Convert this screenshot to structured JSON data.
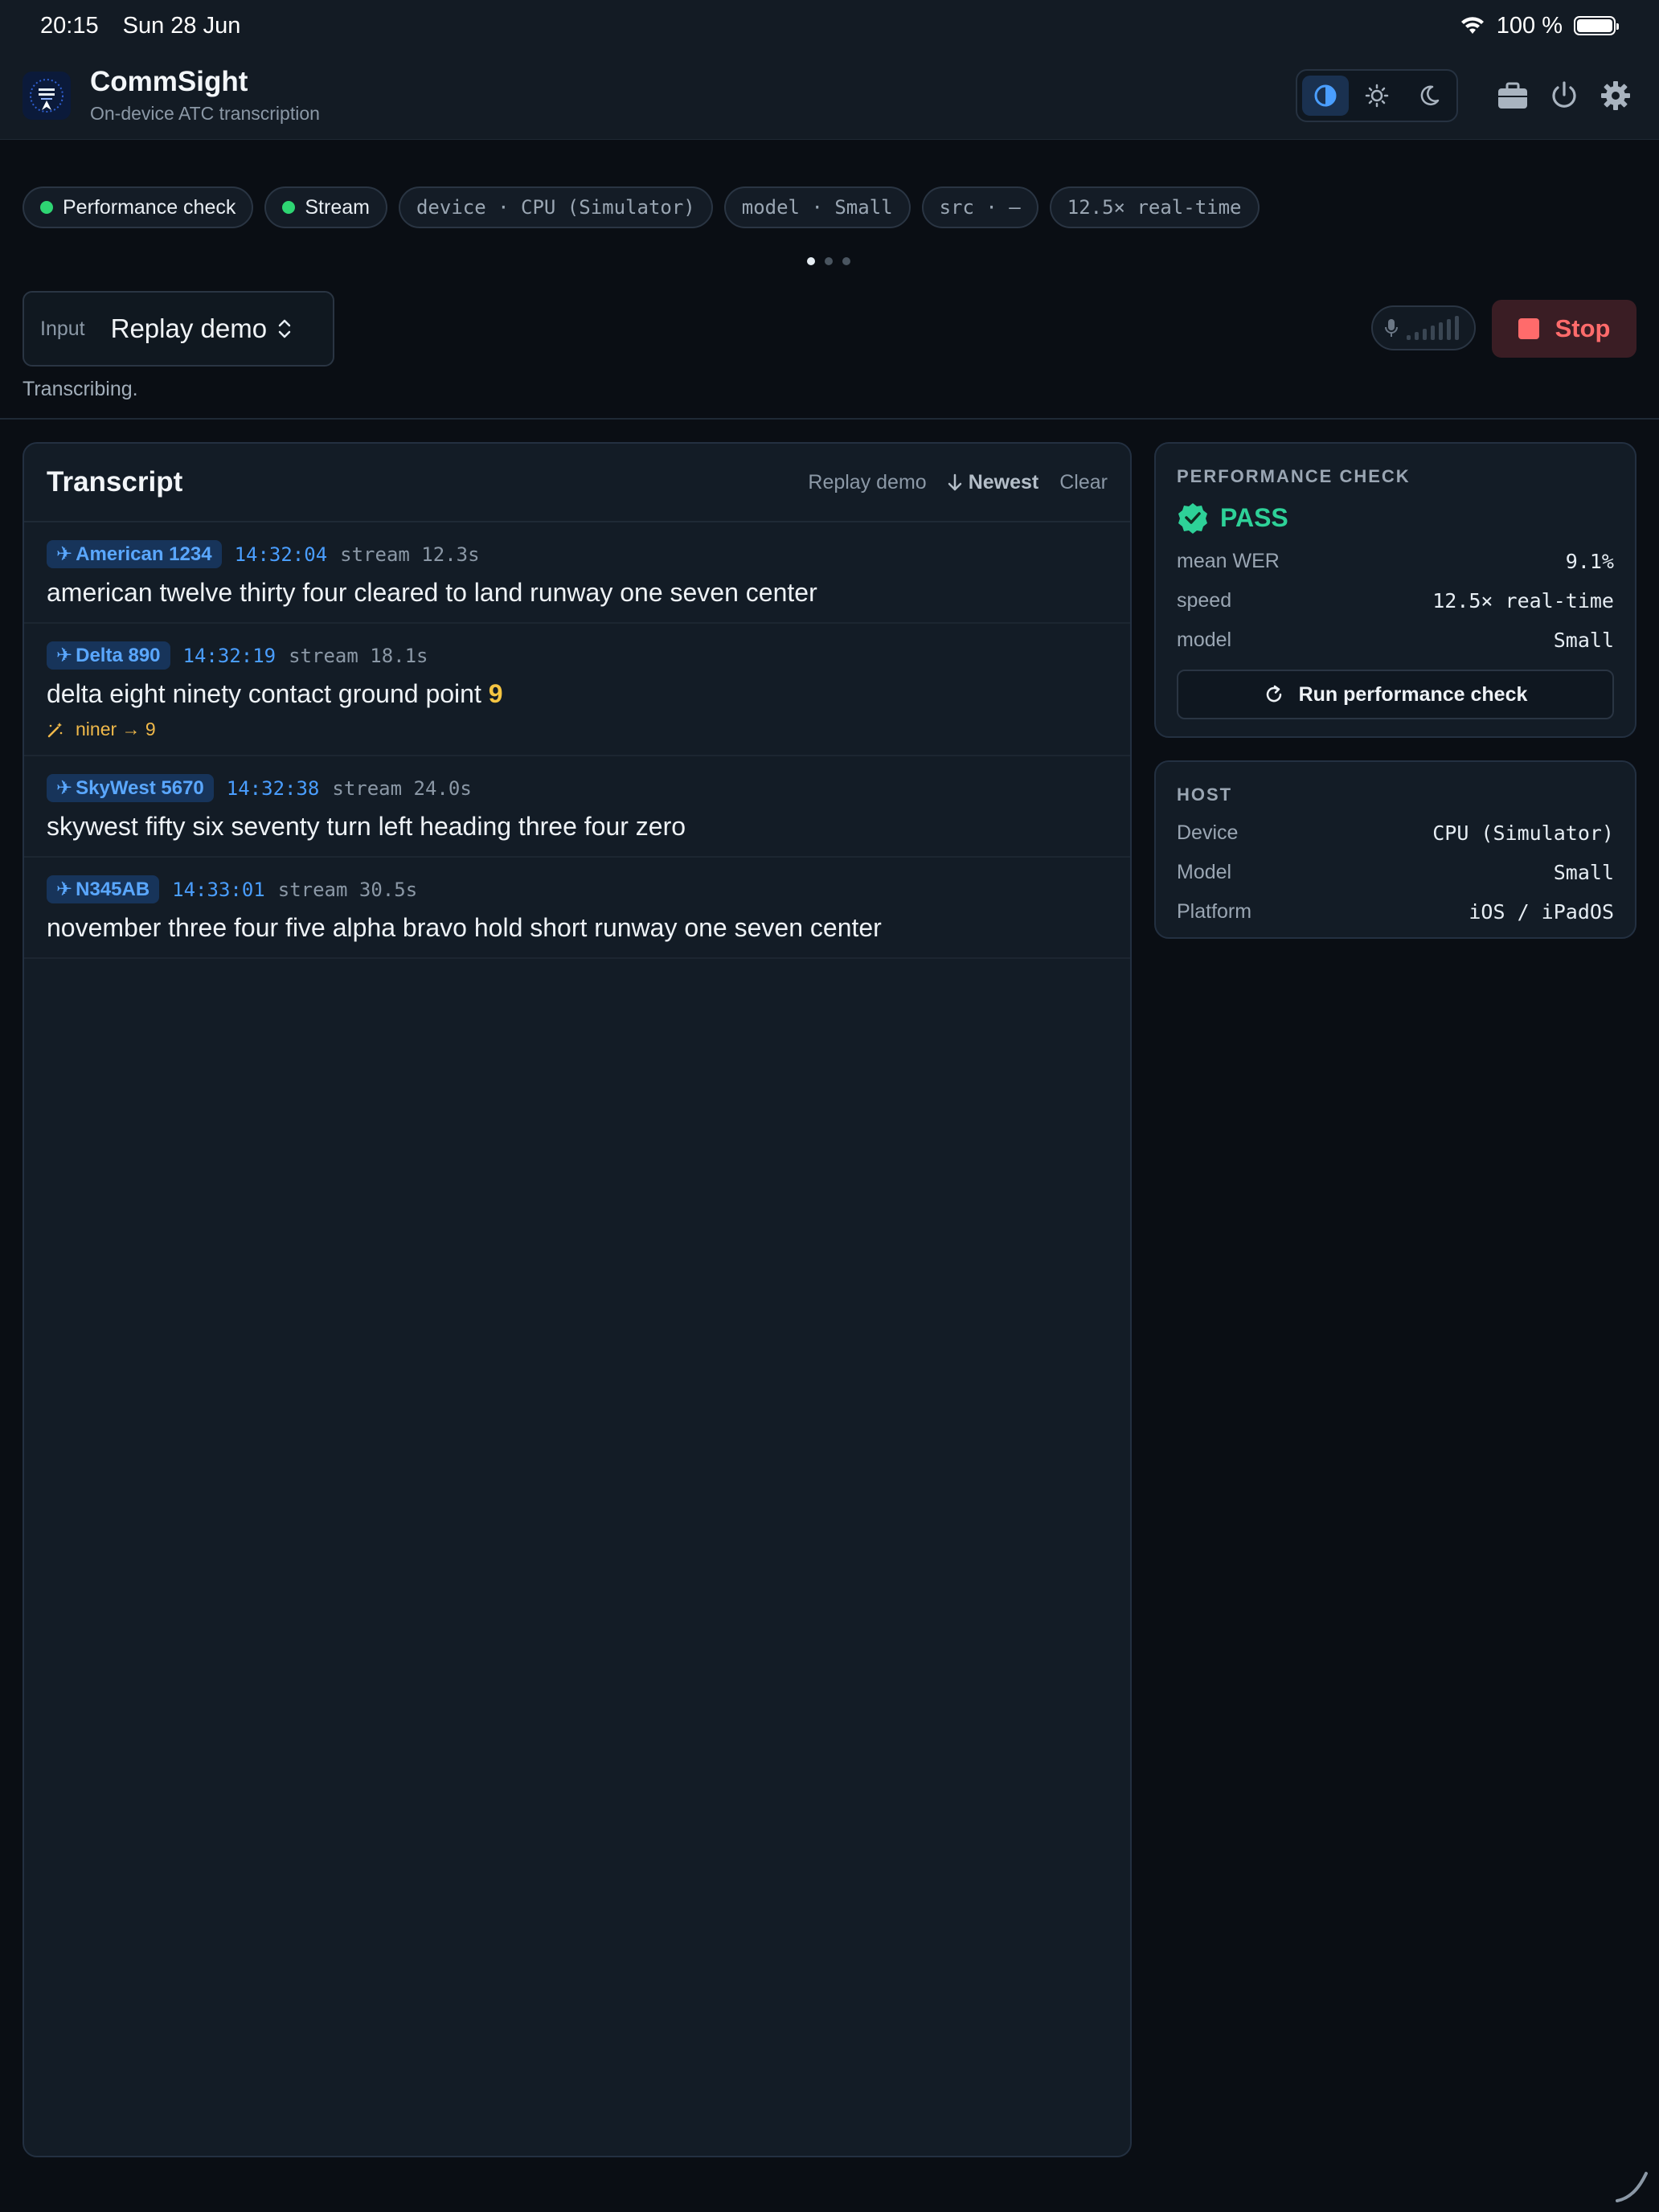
{
  "status_bar": {
    "time": "20:15",
    "date": "Sun 28 Jun",
    "battery": "100 %"
  },
  "header": {
    "title": "CommSight",
    "subtitle": "On-device ATC transcription"
  },
  "chips": [
    {
      "label": "Performance check",
      "type": "status"
    },
    {
      "label": "Stream",
      "type": "status"
    },
    {
      "label": "device · CPU (Simulator)",
      "type": "mono"
    },
    {
      "label": "model · Small",
      "type": "mono"
    },
    {
      "label": "src · —",
      "type": "mono"
    },
    {
      "label": "12.5× real-time",
      "type": "mono"
    }
  ],
  "controls": {
    "input_label": "Input",
    "input_value": "Replay demo",
    "stop_label": "Stop",
    "status_text": "Transcribing."
  },
  "transcript": {
    "title": "Transcript",
    "actions": {
      "replay": "Replay demo",
      "newest": "Newest",
      "clear": "Clear"
    },
    "entries": [
      {
        "callsign": "American 1234",
        "time": "14:32:04",
        "stream": "stream 12.3s",
        "text": "american twelve thirty four cleared to land runway one seven center"
      },
      {
        "callsign": "Delta 890",
        "time": "14:32:19",
        "stream": "stream 18.1s",
        "text": "delta eight ninety contact ground point",
        "highlight": "9",
        "correction": "niner → 9"
      },
      {
        "callsign": "SkyWest 5670",
        "time": "14:32:38",
        "stream": "stream 24.0s",
        "text": "skywest fifty six seventy turn left heading three four zero"
      },
      {
        "callsign": "N345AB",
        "time": "14:33:01",
        "stream": "stream 30.5s",
        "text": "november three four five alpha bravo hold short runway one seven center"
      }
    ]
  },
  "performance": {
    "heading": "PERFORMANCE CHECK",
    "result": "PASS",
    "rows": [
      {
        "k": "mean WER",
        "v": "9.1%"
      },
      {
        "k": "speed",
        "v": "12.5× real-time"
      },
      {
        "k": "model",
        "v": "Small"
      }
    ],
    "button": "Run performance check"
  },
  "host": {
    "heading": "HOST",
    "rows": [
      {
        "k": "Device",
        "v": "CPU (Simulator)"
      },
      {
        "k": "Model",
        "v": "Small"
      },
      {
        "k": "Platform",
        "v": "iOS / iPadOS"
      }
    ]
  },
  "colors": {
    "accent": "#4a9eff",
    "pass": "#2ed198",
    "stop": "#ff6b6b",
    "highlight": "#f5c542"
  },
  "icons": {
    "theme": [
      "contrast-icon",
      "sun-icon",
      "moon-icon"
    ],
    "header": [
      "briefcase-icon",
      "power-icon",
      "gear-icon"
    ]
  }
}
